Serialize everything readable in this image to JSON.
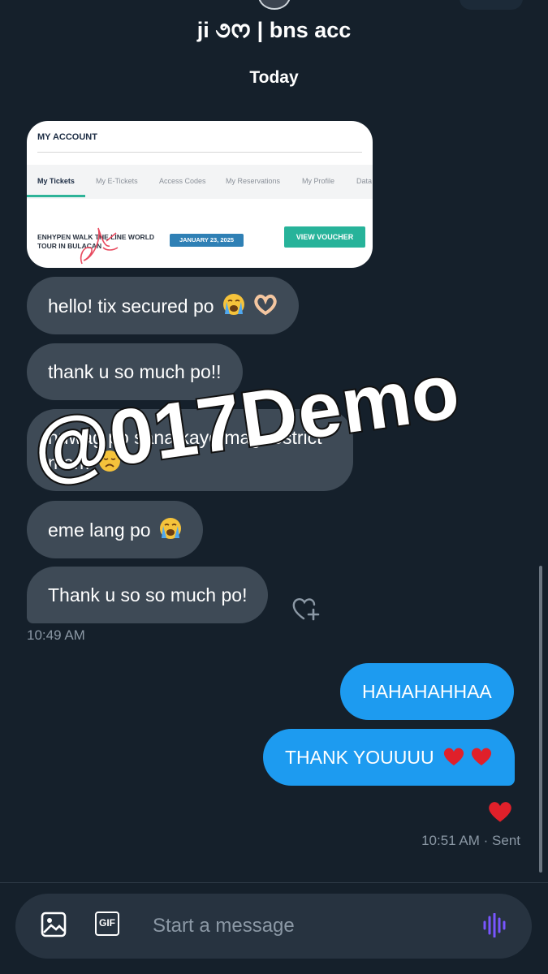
{
  "header": {
    "title": "ji ૭ᰔ | bns acc"
  },
  "conversation": {
    "date_separator": "Today",
    "attachment": {
      "account_title": "MY ACCOUNT",
      "tabs": [
        "My Tickets",
        "My E-Tickets",
        "Access Codes",
        "My Reservations",
        "My Profile",
        "Data"
      ],
      "event_name": "ENHYPEN WALK THE LINE WORLD TOUR IN BULACAN",
      "event_date": "JANUARY 23, 2025",
      "voucher_button": "VIEW VOUCHER"
    },
    "received": [
      {
        "text": "hello! tix secured po",
        "emoji": [
          "crying-face",
          "heart-hands"
        ]
      },
      {
        "text": "thank u so much po!!",
        "emoji": []
      },
      {
        "text": "huwag po sana kayo mag restrict mam",
        "emoji": [
          "disappointed-face"
        ]
      },
      {
        "text": "eme lang po",
        "emoji": [
          "crying-face"
        ]
      },
      {
        "text": "Thank u so so much po!",
        "emoji": []
      }
    ],
    "received_time": "10:49 AM",
    "sent": [
      {
        "text": "HAHAHAHHAA",
        "emoji": []
      },
      {
        "text": "THANK YOUUUU",
        "emoji": [
          "red-heart",
          "red-heart"
        ]
      }
    ],
    "reaction": "red-heart",
    "sent_status": "10:51 AM · Sent"
  },
  "watermark": "@017Demo",
  "composer": {
    "placeholder": "Start a message",
    "gif_label": "GIF"
  },
  "colors": {
    "background": "#15202b",
    "received_bubble": "#3e4a56",
    "sent_bubble": "#1d9bf0",
    "voice_icon": "#7856ff"
  }
}
